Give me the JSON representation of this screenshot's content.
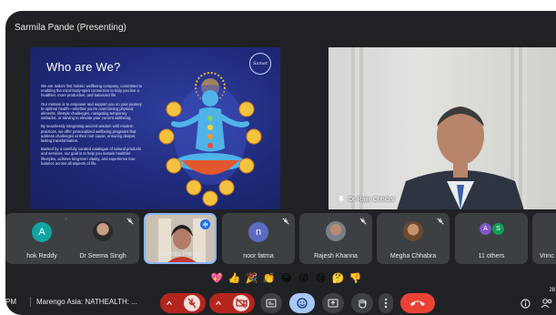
{
  "header": {
    "presenting_label": "Sarmila Pande (Presenting)"
  },
  "slide": {
    "title": "Who are We?",
    "logo_text": "Samet",
    "paragraphs": [
      "We are India's first holistic wellbeing company, committed to enabling the mind-body-spirit connection to help you live a healthier, more productive, and balanced life.",
      "Our mission is to empower and support you on your journey to optimal health—whether you're overcoming physical ailments, lifestyle challenges, navigating temporary setbacks, or striving to elevate your current wellbeing.",
      "By seamlessly integrating ancient wisdom with modern practices, we offer personalized wellbeing programs that address challenges at their root cause, ensuring deeper, lasting transformation.",
      "Backed by a carefully curated catalogue of natural products and services, our goal is to help you sustain healthier lifestyles, achieve long-term vitality, and experience true balance across all aspects of life."
    ]
  },
  "speaker": {
    "name": "Dr Rajiv Chhibal"
  },
  "participants": [
    {
      "name": "hok Reddy",
      "avatar_letter": "A",
      "avatar_color": "#12a4a0"
    },
    {
      "name": "Dr Seema Singh"
    },
    {
      "name": "Sarmila Pande",
      "active": true
    },
    {
      "name": "noor fatma",
      "avatar_letter": "n",
      "avatar_color": "#5c6bc0"
    },
    {
      "name": "Rajesh Khanna"
    },
    {
      "name": "Megha Chhabra"
    },
    {
      "name": "11 others",
      "mini_avatars": [
        "A",
        "S"
      ]
    },
    {
      "name": "Vrinc"
    }
  ],
  "reactions": [
    "💖",
    "👍",
    "🎉",
    "👏",
    "😂",
    "😮",
    "😢",
    "🤔",
    "👎"
  ],
  "toolbar": {
    "time": "PM",
    "meeting_name": "Marengo Asia: NATHEALTH: ...",
    "people_count": "28"
  },
  "colors": {
    "background": "#202124",
    "tile": "#3c4043",
    "danger": "#b3261e",
    "active": "#8ab4f8",
    "hangup": "#ea4335"
  }
}
